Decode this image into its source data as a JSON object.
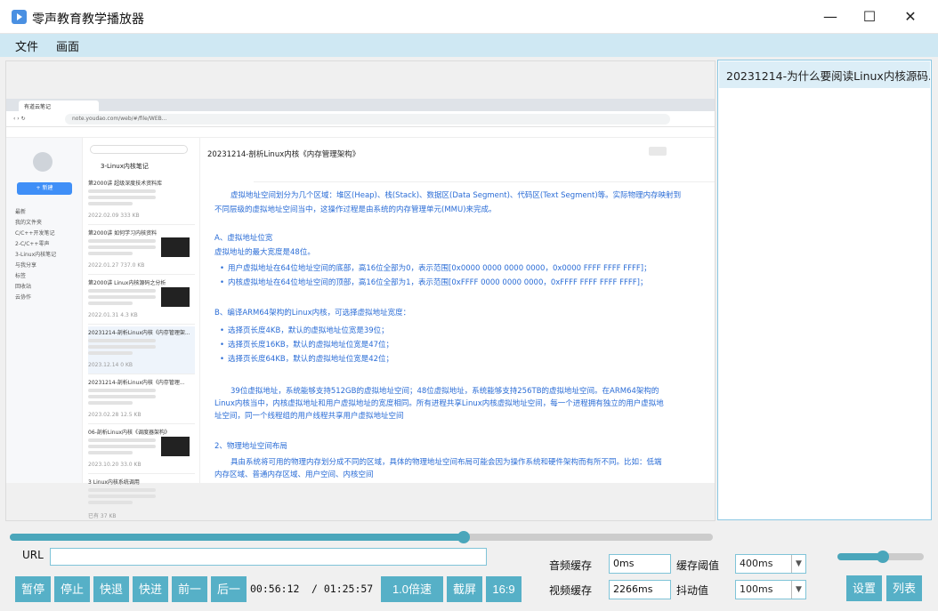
{
  "window": {
    "title": "零声教育教学播放器",
    "minimize": "—",
    "maximize": "☐",
    "close": "✕"
  },
  "menu": [
    "文件",
    "画面"
  ],
  "playlist": {
    "items": [
      "20231214-为什么要阅读Linux内核源码..."
    ]
  },
  "video_frame": {
    "browser_tab": "有道云笔记",
    "browser_url": "note.youdao.com/web/#/file/WEB...",
    "doc_title": "20231214-剖析Linux内核《内存管理架构》",
    "note_header": "3-Linux内核笔记",
    "new_button": "+ 新建",
    "left_nav": [
      "最新",
      "我的文件夹",
      "C/C++开发笔记",
      "2-C/C++零声",
      "3-Linux内核笔记",
      "与我分享",
      "标签",
      "回收站",
      "云协作"
    ],
    "cards": [
      {
        "title": "第2000讲 超级深度技术资料库",
        "date": "2022.02.09  333 KB"
      },
      {
        "title": "第2000讲 如何学习内核资料",
        "date": "2022.01.27  737.0 KB"
      },
      {
        "title": "第2000讲 Linux内核源码之分析",
        "date": "2022.01.31  4.3 KB"
      },
      {
        "title": "20231214-剖析Linux内核《内存管理架...",
        "date": "2023.12.14  0 KB"
      },
      {
        "title": "20231214-剖析Linux内核《内存管理...",
        "date": "2023.02.28  12.5 KB"
      },
      {
        "title": "06-剖析Linux内核《调度器架构》",
        "date": "2023.10.20  33.0 KB"
      },
      {
        "title": "3 Linux内核系统调用",
        "date": "已有 37 KB"
      }
    ],
    "paragraphs": [
      {
        "text": "虚拟地址空间划分为几个区域：堆区(Heap)、栈(Stack)、数据区(Data Segment)、代码区(Text Segment)等。实际物理内存映射到",
        "type": "p"
      },
      {
        "text": "不同层级的虚拟地址空间当中，这操作过程是由系统的内存管理单元(MMU)来完成。",
        "type": "p"
      },
      {
        "text": "A、虚拟地址位宽",
        "type": "h"
      },
      {
        "text": "虚拟地址的最大宽度是48位。",
        "type": "p"
      },
      {
        "text": "用户虚拟地址在64位地址空间的底部，高16位全部为0，表示范围[0x0000 0000 0000 0000，0x0000 FFFF FFFF FFFF]；",
        "type": "li"
      },
      {
        "text": "内核虚拟地址在64位地址空间的顶部，高16位全部为1，表示范围[0xFFFF 0000 0000 0000，0xFFFF FFFF FFFF FFFF]；",
        "type": "li"
      },
      {
        "text": "B、编译ARM64架构的Linux内核，可选择虚拟地址宽度：",
        "type": "h"
      },
      {
        "text": "选择页长度4KB，默认的虚拟地址位宽是39位；",
        "type": "li"
      },
      {
        "text": "选择页长度16KB，默认的虚拟地址位宽是47位；",
        "type": "li"
      },
      {
        "text": "选择页长度64KB，默认的虚拟地址位宽是42位；",
        "type": "li"
      },
      {
        "text": "39位虚拟地址，系统能够支持512GB的虚拟地址空间；48位虚拟地址，系统能够支持256TB的虚拟地址空间。在ARM64架构的",
        "type": "p"
      },
      {
        "text": "Linux内核当中，内核虚拟地址和用户虚拟地址的宽度相同。所有进程共享Linux内核虚拟地址空间，每一个进程拥有独立的用户虚拟地",
        "type": "p"
      },
      {
        "text": "址空间，同一个线程组的用户线程共享用户虚拟地址空间",
        "type": "p"
      },
      {
        "text": "2、物理地址空间布局",
        "type": "h"
      },
      {
        "text": "具由系统将可用的物理内存划分成不同的区域，具体的物理地址空间布局可能会因为操作系统和硬件架构而有所不同。比如：低端",
        "type": "p"
      },
      {
        "text": "内存区域、普通内存区域、用户空间、内核空间",
        "type": "p"
      }
    ]
  },
  "progress": {
    "played_fraction": 0.646
  },
  "volume": {
    "level_fraction": 0.53
  },
  "url": {
    "label": "URL",
    "value": ""
  },
  "buffers": {
    "audio_label": "音频缓存",
    "audio_value": "0ms",
    "video_label": "视频缓存",
    "video_value": "2266ms",
    "threshold_label": "缓存阈值",
    "threshold_value": "400ms",
    "jitter_label": "抖动值",
    "jitter_value": "100ms"
  },
  "controls": {
    "pause": "暂停",
    "stop": "停止",
    "rewind": "快退",
    "forward": "快进",
    "prev": "前一",
    "next": "后一",
    "current_time": "00:56:12",
    "total_time": "/ 01:25:57",
    "speed": "1.0倍速",
    "screenshot": "截屏",
    "aspect": "16:9",
    "settings": "设置",
    "list": "列表"
  }
}
